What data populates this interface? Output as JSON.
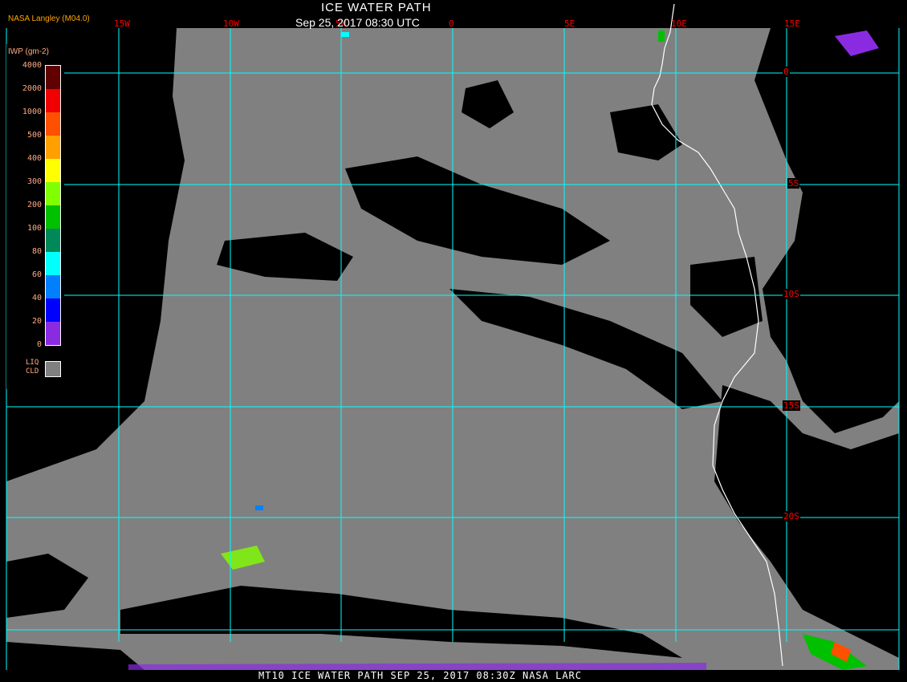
{
  "header": {
    "title": "ICE WATER PATH",
    "subtitle": "Sep 25, 2017 08:30 UTC",
    "credit": "NASA Langley (M04.0)"
  },
  "longitude_labels": [
    "15W",
    "10W",
    "5W",
    "0",
    "5E",
    "10E",
    "15E"
  ],
  "latitude_labels": [
    "0",
    "5S",
    "10S",
    "15S",
    "20S"
  ],
  "legend": {
    "unit": "IWP (gm-2)",
    "levels": [
      "4000",
      "2000",
      "1000",
      "500",
      "400",
      "300",
      "200",
      "100",
      "80",
      "60",
      "40",
      "20",
      "0"
    ],
    "colors": [
      "#600000",
      "#f00000",
      "#ff5000",
      "#ffa000",
      "#ffff00",
      "#80ff00",
      "#00c000",
      "#008858",
      "#00ffff",
      "#0080ff",
      "#0000ff",
      "#8a2be2"
    ],
    "liquid_cloud_label": "LIQ CLD",
    "liquid_cloud_color": "#808080"
  },
  "colors": {
    "grid": "#00ffff",
    "cloud": "#808080",
    "clear": "#000000",
    "coastline": "#ffffff"
  },
  "footer": "MT10  ICE WATER PATH   SEP 25, 2017 08:30Z   NASA LARC"
}
